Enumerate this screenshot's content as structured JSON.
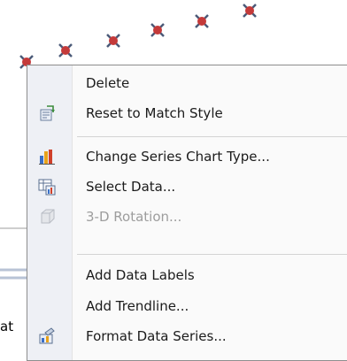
{
  "background": {
    "partial_text": "at",
    "marker_color": "#c43a3a"
  },
  "context_menu": {
    "items": [
      {
        "label": "Delete",
        "icon": "none",
        "enabled": true
      },
      {
        "label": "Reset to Match Style",
        "icon": "reset-style-icon",
        "enabled": true
      },
      {
        "label": "Change Series Chart Type...",
        "icon": "chart-type-icon",
        "enabled": true
      },
      {
        "label": "Select Data...",
        "icon": "select-data-icon",
        "enabled": true
      },
      {
        "label": "3-D Rotation...",
        "icon": "3d-rotation-icon",
        "enabled": false
      },
      {
        "label": "Add Data Labels",
        "icon": "none",
        "enabled": true
      },
      {
        "label": "Add Trendline...",
        "icon": "none",
        "enabled": true
      },
      {
        "label": "Format Data Series...",
        "icon": "format-series-icon",
        "enabled": true
      }
    ]
  }
}
